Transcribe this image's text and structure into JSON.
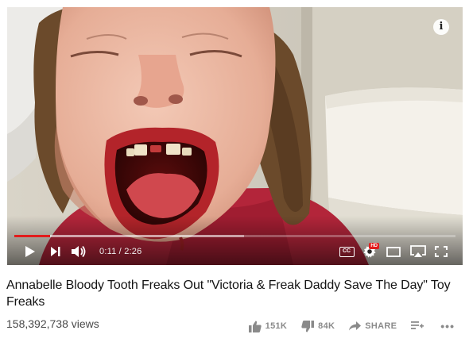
{
  "player": {
    "info_glyph": "i",
    "progress_fraction": 0.0813,
    "loaded_fraction": 0.52,
    "time_current": "0:11",
    "time_separator": " / ",
    "time_total": "2:26",
    "cc_label": "CC",
    "hd_badge": "HD",
    "accent_color": "#e21c1c"
  },
  "video": {
    "title": "Annabelle Bloody Tooth Freaks Out \"Victoria & Freak Daddy Save The Day\" Toy Freaks",
    "views": "158,392,738 views"
  },
  "actions": {
    "like_count": "151K",
    "dislike_count": "84K",
    "share_label": "SHARE",
    "more_glyph": "•••"
  },
  "icons": {
    "info": "info-icon",
    "play": "play-icon",
    "next": "next-icon",
    "volume": "volume-icon",
    "captions": "captions-icon",
    "settings": "gear-icon",
    "miniplayer": "miniplayer-icon",
    "airplay": "airplay-icon",
    "fullscreen": "fullscreen-icon",
    "like": "thumbs-up-icon",
    "dislike": "thumbs-down-icon",
    "share": "share-arrow-icon",
    "add_to": "add-to-playlist-icon",
    "more": "more-dots-icon"
  }
}
